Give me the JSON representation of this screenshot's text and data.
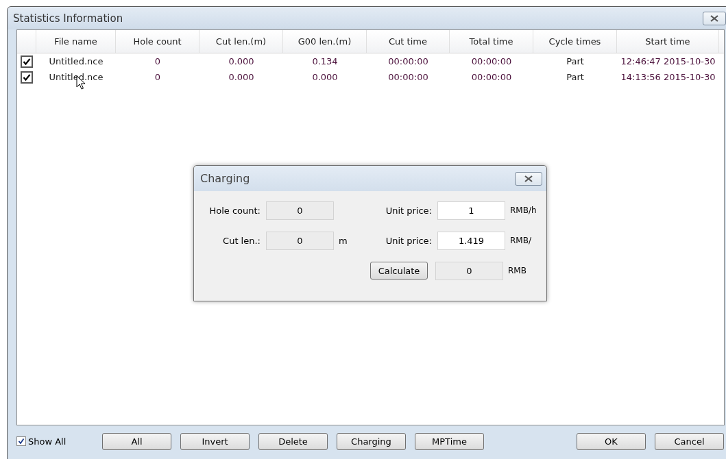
{
  "window": {
    "title": "Statistics Information"
  },
  "table": {
    "columns": [
      "File name",
      "Hole count",
      "Cut len.(m)",
      "G00 len.(m)",
      "Cut time",
      "Total time",
      "Cycle times",
      "Start time"
    ],
    "rows": [
      {
        "checked": true,
        "cells": [
          "Untitled.nce",
          "0",
          "0.000",
          "0.134",
          "00:00:00",
          "00:00:00",
          "Part",
          "12:46:47 2015-10-30"
        ]
      },
      {
        "checked": true,
        "cells": [
          "Untitled.nce",
          "0",
          "0.000",
          "0.000",
          "00:00:00",
          "00:00:00",
          "Part",
          "14:13:56 2015-10-30"
        ]
      }
    ]
  },
  "show_all": {
    "label": "Show All",
    "checked": true
  },
  "buttons": [
    "All",
    "Invert",
    "Delete",
    "Charging",
    "MPTime"
  ],
  "dialog_buttons": [
    "OK",
    "Cancel"
  ],
  "charging": {
    "title": "Charging",
    "rows": [
      {
        "left": {
          "label": "Hole count:",
          "value": "0"
        },
        "right": {
          "label": "Unit price:",
          "value": "1",
          "unit": "RMB/h"
        }
      },
      {
        "left": {
          "label": "Cut len.:",
          "value": "0",
          "unit": "m"
        },
        "right": {
          "label": "Unit price:",
          "value": "1.419",
          "unit": "RMB/"
        }
      }
    ],
    "calculate": {
      "button": "Calculate",
      "value": "0",
      "unit": "RMB"
    }
  }
}
